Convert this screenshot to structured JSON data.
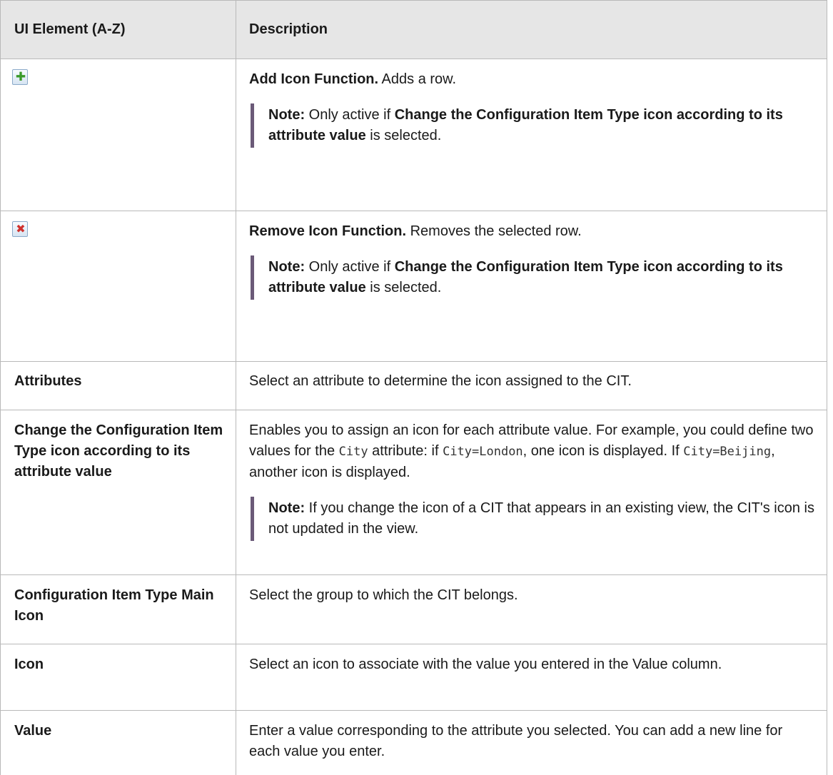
{
  "header": {
    "col1": "UI Element (A-Z)",
    "col2": "Description"
  },
  "rows": {
    "add": {
      "icon": "add-plus-icon",
      "title": "Add Icon Function.",
      "text": " Adds a row.",
      "note_label": "Note:",
      "note_pre": " Only active if ",
      "note_bold": "Change the Configuration Item Type icon according to its attribute value",
      "note_post": " is selected."
    },
    "remove": {
      "icon": "remove-x-icon",
      "title": "Remove Icon Function.",
      "text": " Removes the selected row.",
      "note_label": "Note:",
      "note_pre": " Only active if ",
      "note_bold": "Change the Configuration Item Type icon according to its attribute value",
      "note_post": " is selected."
    },
    "attributes": {
      "element": "Attributes",
      "description": "Select an attribute to determine the icon assigned to the CIT."
    },
    "change": {
      "element": "Change the Configuration Item Type icon according to its attribute value",
      "d1": "Enables you to assign an icon for each attribute value. For example, you could define two values for the ",
      "code1": "City",
      "d2": " attribute: if ",
      "code2": "City=London",
      "d3": ", one icon is displayed. If ",
      "code3": "City=Beijing",
      "d4": ", another icon is displayed.",
      "note_label": "Note:",
      "note_text": " If you change the icon of a CIT that appears in an existing view, the CIT's icon is not updated in the view."
    },
    "main_icon": {
      "element": "Configuration Item Type Main Icon",
      "description": "Select the group to which the CIT belongs."
    },
    "icon": {
      "element": "Icon",
      "description": "Select an icon to associate with the value you entered in the Value column."
    },
    "value": {
      "element": "Value",
      "description": "Enter a value corresponding to the attribute you selected. You can add a new line for each value you enter."
    }
  }
}
